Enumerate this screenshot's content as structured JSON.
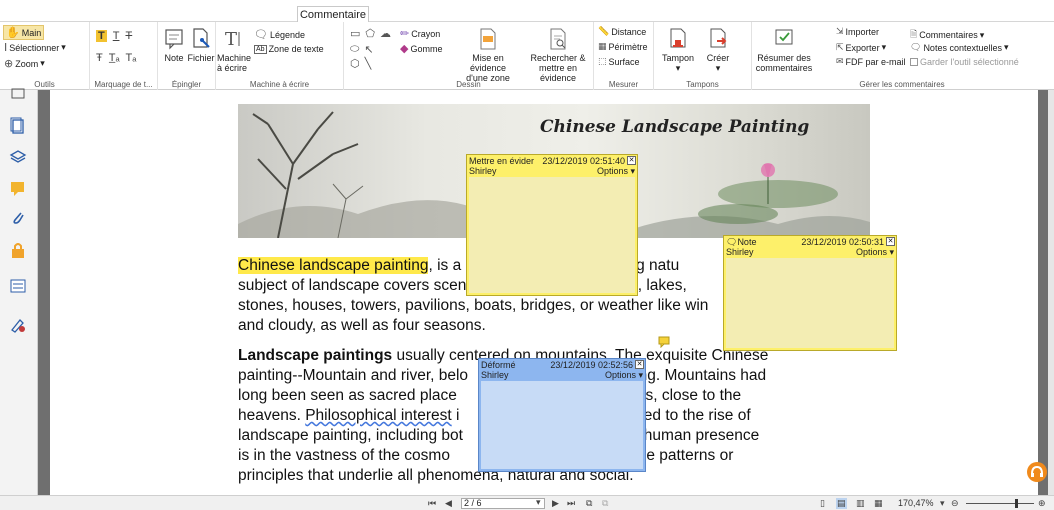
{
  "ribbon": {
    "active_tab": "Commentaire",
    "groups": {
      "outils": {
        "label": "Outils",
        "main": "Main",
        "select": "Sélectionner",
        "zoom": "Zoom"
      },
      "marquage": {
        "label": "Marquage de t..."
      },
      "epingler": {
        "label": "Épingler",
        "note": "Note",
        "file": "Fichier"
      },
      "machine": {
        "label": "Machine à écrire",
        "machine_line1": "Machine",
        "machine_line2": "à écrire",
        "legende": "Légende",
        "zone_texte": "Zone de texte"
      },
      "dessin": {
        "label": "Dessin",
        "crayon": "Crayon",
        "gomme": "Gomme",
        "mise_line1": "Mise en évidence",
        "mise_line2": "d'une zone",
        "recherche_line1": "Rechercher &",
        "recherche_line2": "mettre en évidence"
      },
      "mesurer": {
        "label": "Mesurer",
        "distance": "Distance",
        "perimetre": "Périmètre",
        "surface": "Surface"
      },
      "tampons": {
        "label": "Tampons",
        "tampon": "Tampon",
        "creer": "Créer"
      },
      "gerer": {
        "label": "Gérer les commentaires",
        "resumer_line1": "Résumer des",
        "resumer_line2": "commentaires",
        "importer": "Importer",
        "exporter": "Exporter",
        "fdf": "FDF par e-mail",
        "commentaires": "Commentaires",
        "notes_ctx": "Notes contextuelles",
        "garder": "Garder l'outil sélectionné"
      }
    }
  },
  "document": {
    "banner_title": "Chinese Landscape Painting",
    "para1": {
      "highlight": "Chinese landscape painting",
      "line1_rest": ", is a kind of painting describing natu",
      "line2": "subject of landscape covers scenery like mountains, rivers, lakes,",
      "line3": "stones, houses, towers, pavilions, boats, bridges, or weather like win",
      "line4": "and cloudy, as well as four seasons."
    },
    "para2": {
      "bold": "Landscape paintings",
      "line1_rest": " usually centered on mountains. The exquisite Chinese",
      "line2": "painting--Mountain and river, belo                          be painting. Mountains had",
      "line3": "long been seen as sacred place                          of immortals, close to the",
      "line4_pre": "heavens. ",
      "line4_squig": "Philosophical interest",
      "line4_post": " i                          e contributed to the rise of",
      "line5": "landscape painting, including bot                          minor the human presence",
      "line6": "is in the vastness of the cosmo                          interest in the patterns or",
      "line7": "principles that underlie all phenomena, natural and social."
    }
  },
  "notes": [
    {
      "type": "Mettre en évider",
      "date": "23/12/2019 02:51:40",
      "author": "Shirley",
      "options": "Options"
    },
    {
      "type": "Note",
      "date": "23/12/2019 02:50:31",
      "author": "Shirley",
      "options": "Options"
    },
    {
      "type": "Déformé",
      "date": "23/12/2019 02:52:56",
      "author": "Shirley",
      "options": "Options"
    }
  ],
  "statusbar": {
    "page": "2 / 6",
    "zoom": "170,47%"
  },
  "colors": {
    "highlight": "#ffe94a",
    "note_yellow": "#fdf06a",
    "note_blue": "#8db6ef",
    "viewer_bg": "#6f6f6f"
  }
}
